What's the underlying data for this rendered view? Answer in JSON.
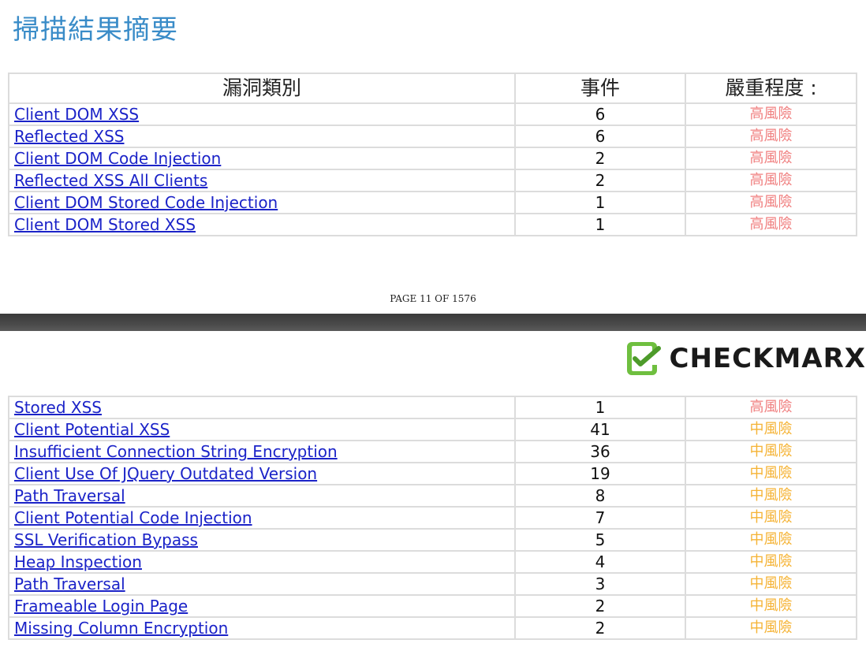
{
  "page1": {
    "title": "掃描結果摘要",
    "headers": {
      "category": "漏洞類別",
      "count": "事件",
      "severity": "嚴重程度 :"
    },
    "rows": [
      {
        "name": "Client DOM XSS",
        "count": "6",
        "severity": "高風險",
        "level": "high"
      },
      {
        "name": "Reflected XSS",
        "count": "6",
        "severity": "高風險",
        "level": "high"
      },
      {
        "name": "Client DOM Code Injection",
        "count": "2",
        "severity": "高風險",
        "level": "high"
      },
      {
        "name": "Reflected XSS All Clients",
        "count": "2",
        "severity": "高風險",
        "level": "high"
      },
      {
        "name": "Client DOM Stored Code Injection",
        "count": "1",
        "severity": "高風險",
        "level": "high"
      },
      {
        "name": "Client DOM Stored XSS",
        "count": "1",
        "severity": "高風險",
        "level": "high"
      }
    ],
    "footer": "PAGE 11 OF 1576"
  },
  "brand": {
    "name": "CHECKMARX",
    "colors": {
      "icon_green": "#6fbf3f",
      "text": "#1a1a1a"
    }
  },
  "page2": {
    "rows": [
      {
        "name": "Stored XSS",
        "count": "1",
        "severity": "高風險",
        "level": "high"
      },
      {
        "name": "Client Potential XSS",
        "count": "41",
        "severity": "中風險",
        "level": "medium"
      },
      {
        "name": "Insufficient Connection String Encryption",
        "count": "36",
        "severity": "中風險",
        "level": "medium"
      },
      {
        "name": "Client Use Of JQuery Outdated Version",
        "count": "19",
        "severity": "中風險",
        "level": "medium"
      },
      {
        "name": "Path Traversal",
        "count": "8",
        "severity": "中風險",
        "level": "medium"
      },
      {
        "name": "Client Potential Code Injection",
        "count": "7",
        "severity": "中風險",
        "level": "medium"
      },
      {
        "name": "SSL Verification Bypass",
        "count": "5",
        "severity": "中風險",
        "level": "medium"
      },
      {
        "name": "Heap Inspection",
        "count": "4",
        "severity": "中風險",
        "level": "medium"
      },
      {
        "name": "Path Traversal",
        "count": "3",
        "severity": "中風險",
        "level": "medium"
      },
      {
        "name": "Frameable Login Page",
        "count": "2",
        "severity": "中風險",
        "level": "medium"
      },
      {
        "name": "Missing Column Encryption",
        "count": "2",
        "severity": "中風險",
        "level": "medium"
      }
    ]
  },
  "colors": {
    "title": "#3a8cc8",
    "link": "#1b23c8",
    "severity_high": "#f08080",
    "severity_medium": "#f5b335",
    "border": "#dcdcdc"
  }
}
